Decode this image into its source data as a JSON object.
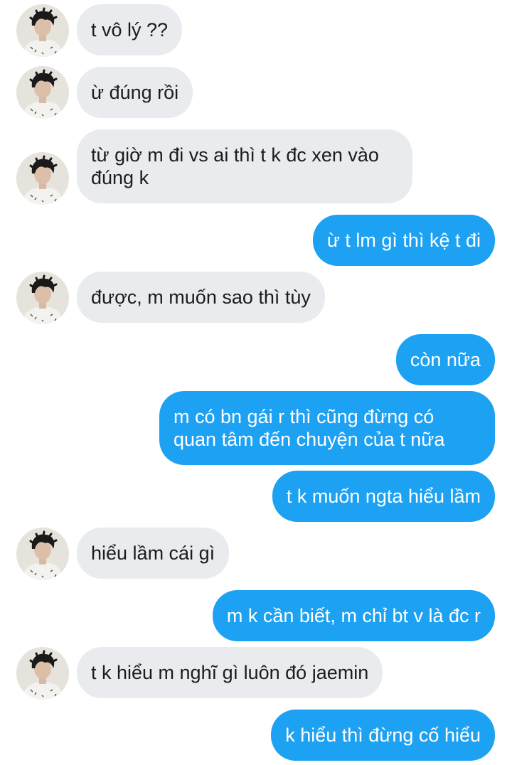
{
  "conversation": {
    "messages": [
      {
        "side": "in",
        "text": "t vô lý ??",
        "avatar": true
      },
      {
        "side": "in",
        "text": "ừ đúng rồi",
        "avatar": true
      },
      {
        "side": "in",
        "text": "từ giờ m đi vs ai thì t k đc xen vào\nđúng k",
        "avatar": true
      },
      {
        "side": "out",
        "text": "ừ t lm gì thì kệ t đi"
      },
      {
        "side": "in",
        "text": "được, m muốn sao thì tùy",
        "avatar": true
      },
      {
        "side": "out",
        "text": "còn nữa"
      },
      {
        "side": "out",
        "text": "m có bn gái r thì cũng đừng có\nquan tâm đến chuyện của t nữa"
      },
      {
        "side": "out",
        "text": "t k muốn ngta hiểu lầm"
      },
      {
        "side": "in",
        "text": "hiểu lầm cái gì",
        "avatar": true
      },
      {
        "side": "out",
        "text": "m k cần biết, m chỉ bt v là đc r"
      },
      {
        "side": "in",
        "text": "t k hiểu m nghĩ gì luôn đó jaemin",
        "avatar": true
      },
      {
        "side": "out",
        "text": "k hiểu thì đừng cố hiểu"
      }
    ]
  },
  "colors": {
    "incoming_bubble": "#e9ebee",
    "outgoing_bubble": "#1da1f2",
    "incoming_text": "#1c1c1c",
    "outgoing_text": "#ffffff"
  }
}
